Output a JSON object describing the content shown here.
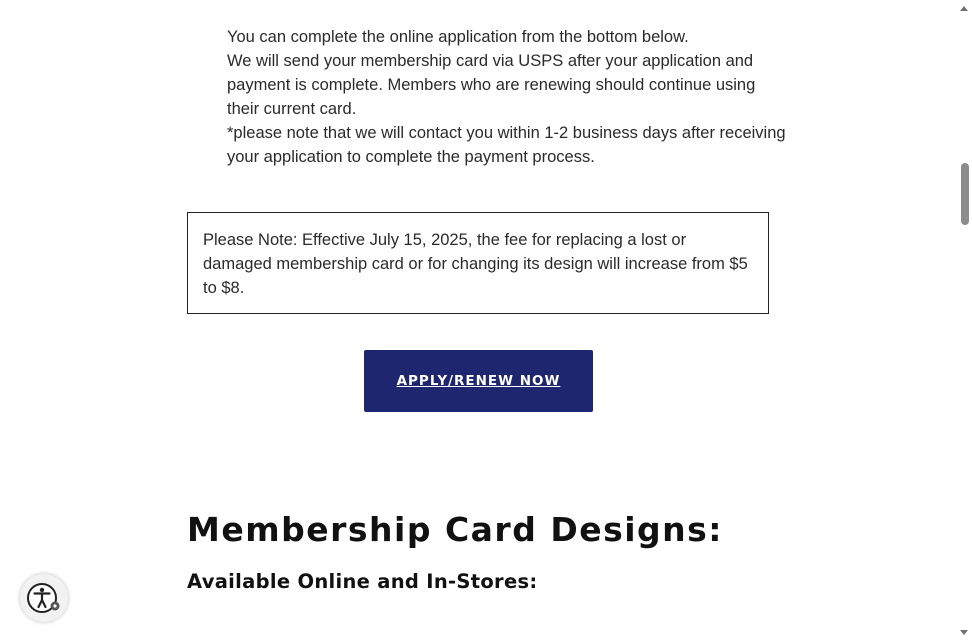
{
  "intro": {
    "line1": "You can complete the online application from the bottom below.",
    "line2": "We will send your membership card via USPS after your application and payment is complete. Members who are renewing should continue using their current card.",
    "line3": "*please note that we will contact you within 1-2 business days after receiving your application to complete the payment process."
  },
  "notice": {
    "text": "Please Note: Effective July 15, 2025, the fee for replacing a lost or damaged membership card or for changing its design will increase from $5 to $8."
  },
  "apply_button": {
    "label": "APPLY/RENEW NOW",
    "color": "#1e2670"
  },
  "section": {
    "title": "Membership Card Designs:",
    "subtitle": "Available Online and In-Stores:"
  },
  "icons": {
    "accessibility": "accessibility-icon",
    "scroll_up": "scroll-up-arrow-icon",
    "scroll_down": "scroll-down-arrow-icon"
  }
}
